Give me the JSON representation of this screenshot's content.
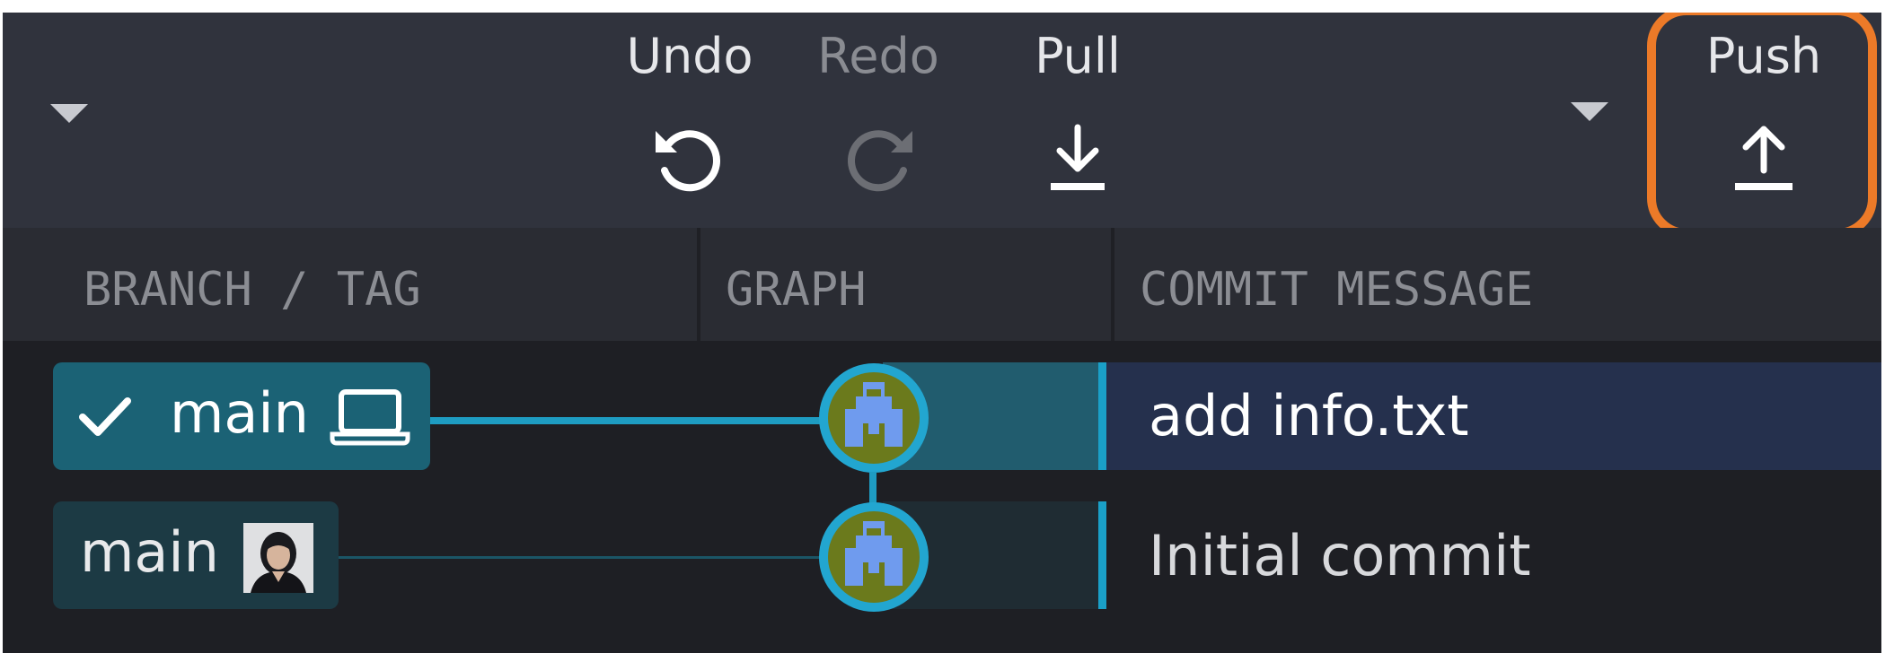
{
  "toolbar": {
    "branch_dropdown_icon": "caret-down-icon",
    "undo": {
      "label": "Undo",
      "icon": "undo-icon"
    },
    "redo": {
      "label": "Redo",
      "icon": "redo-icon"
    },
    "pull": {
      "label": "Pull",
      "icon": "pull-download-icon",
      "dropdown_icon": "caret-down-icon"
    },
    "push": {
      "label": "Push",
      "icon": "push-upload-icon"
    }
  },
  "columns": {
    "branch_tag": "BRANCH / TAG",
    "graph": "GRAPH",
    "commit_message": "COMMIT MESSAGE"
  },
  "commits": [
    {
      "branch_label": "main",
      "checked_out": true,
      "branch_icon": "laptop-icon",
      "message": "add info.txt",
      "selected": true
    },
    {
      "branch_label": "main",
      "checked_out": false,
      "branch_icon": "user-avatar",
      "message": "Initial commit",
      "selected": false
    }
  ],
  "colors": {
    "highlight": "#ec7a28",
    "accent": "#1aa0c8",
    "selected_row": "#25304d",
    "toolbar_bg": "#30333d",
    "list_bg": "#1e1f24"
  }
}
